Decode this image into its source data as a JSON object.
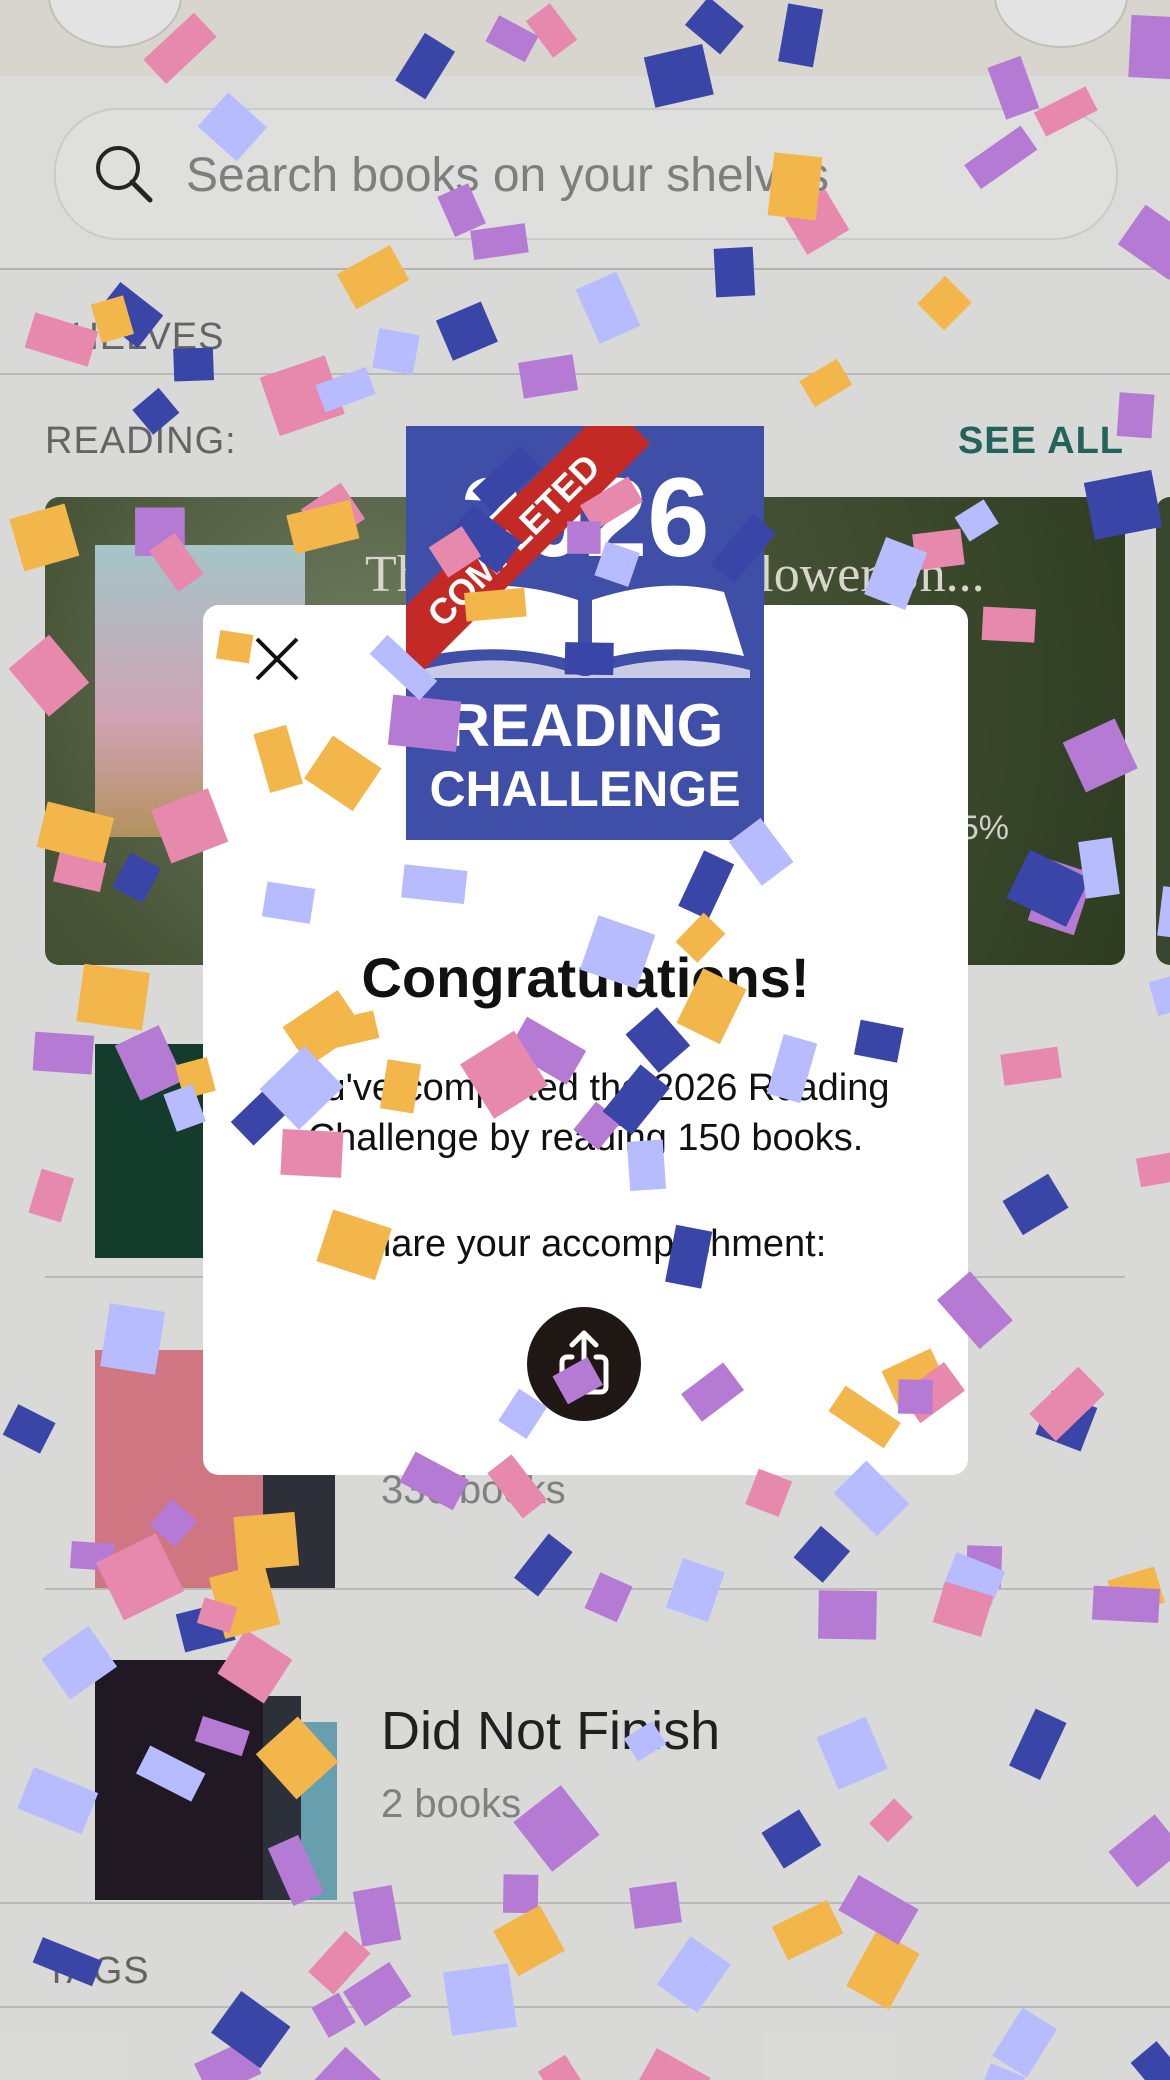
{
  "search": {
    "placeholder": "Search books on your shelves"
  },
  "sections": {
    "shelves": "SHELVES",
    "reading": "READING:",
    "see_all": "SEE ALL",
    "tags": "TAGS"
  },
  "reading_card": {
    "title": "The Daisy Chain Flower Sh...",
    "progress_percent": 45,
    "progress_label": "45%"
  },
  "shelves": [
    {
      "name": "",
      "count": ""
    },
    {
      "name": "",
      "count": "336 books"
    },
    {
      "name": "Did Not Finish",
      "count": "2 books"
    }
  ],
  "modal": {
    "badge": {
      "year": "2026",
      "ribbon": "COMPLETED",
      "line1": "READING",
      "line2": "CHALLENGE"
    },
    "title": "Congratulations!",
    "message": "You've completed the 2026 Reading Challenge by reading 150 books.",
    "share_label": "Share your accomplishment:"
  },
  "icons": {
    "search": "search-icon",
    "close": "close-icon",
    "share": "share-icon"
  },
  "colors": {
    "accent": "#1f6b62",
    "badge_blue": "#3f4ea6",
    "ribbon_red": "#c32a25",
    "confetti": [
      "#f3b64b",
      "#3a45a8",
      "#b57bd4",
      "#e788ad",
      "#b6bcff"
    ]
  }
}
